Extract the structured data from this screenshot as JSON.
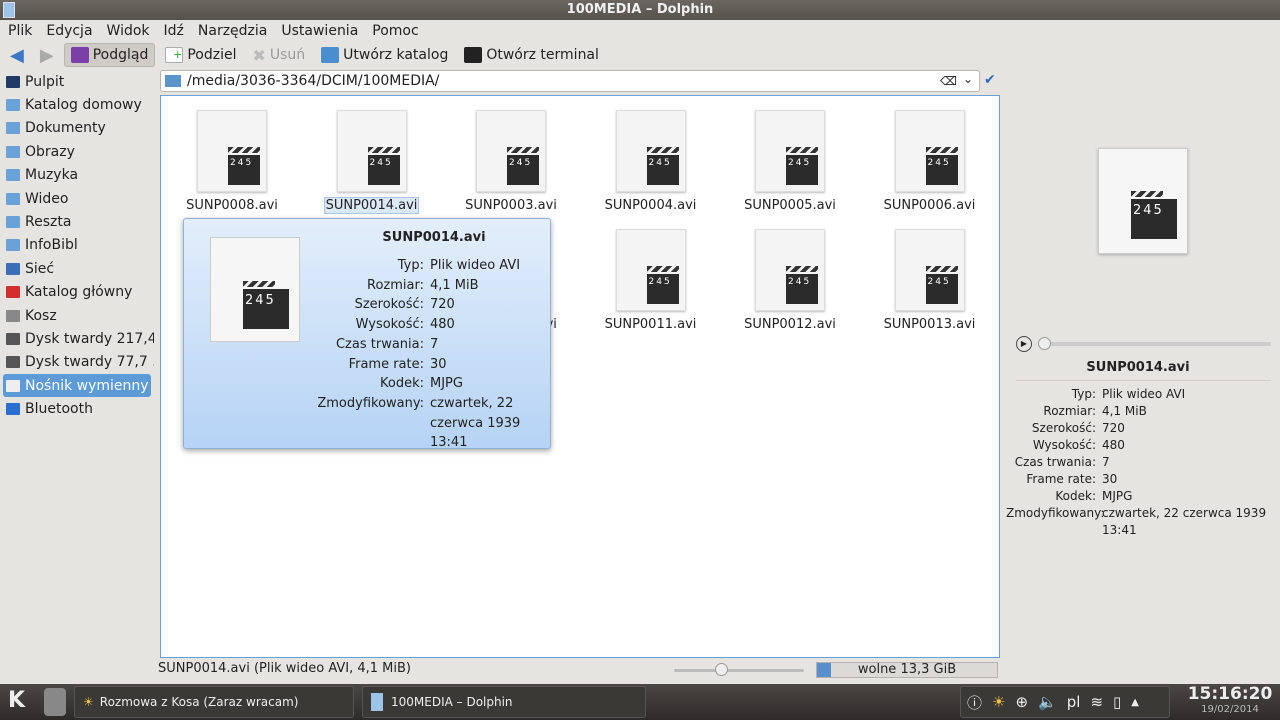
{
  "window": {
    "title": "100MEDIA – Dolphin"
  },
  "menu": [
    "Plik",
    "Edycja",
    "Widok",
    "Idź",
    "Narzędzia",
    "Ustawienia",
    "Pomoc"
  ],
  "toolbar": {
    "preview": "Podgląd",
    "split": "Podziel",
    "delete": "Usuń",
    "new_folder": "Utwórz katalog",
    "terminal": "Otwórz terminal"
  },
  "sidebar": [
    {
      "label": "Pulpit",
      "icon": "desktop-icon"
    },
    {
      "label": "Katalog domowy",
      "icon": "home-folder-icon"
    },
    {
      "label": "Dokumenty",
      "icon": "folder-icon"
    },
    {
      "label": "Obrazy",
      "icon": "folder-icon"
    },
    {
      "label": "Muzyka",
      "icon": "folder-icon"
    },
    {
      "label": "Wideo",
      "icon": "folder-icon"
    },
    {
      "label": "Reszta",
      "icon": "folder-icon"
    },
    {
      "label": "InfoBibl",
      "icon": "folder-icon"
    },
    {
      "label": "Sieć",
      "icon": "network-icon"
    },
    {
      "label": "Katalog główny",
      "icon": "root-folder-icon"
    },
    {
      "label": "Kosz",
      "icon": "trash-icon"
    },
    {
      "label": "Dysk twardy 217,4...",
      "icon": "hard-disk-icon"
    },
    {
      "label": "Dysk twardy 77,7 ...",
      "icon": "hard-disk-icon"
    },
    {
      "label": "Nośnik wymienny ...",
      "icon": "removable-drive-icon",
      "selected": true
    },
    {
      "label": "Bluetooth",
      "icon": "bluetooth-icon"
    }
  ],
  "address": "/media/3036-3364/DCIM/100MEDIA/",
  "files": [
    {
      "name": "SUNP0008.avi"
    },
    {
      "name": "SUNP0014.avi",
      "selected": true
    },
    {
      "name": "SUNP0003.avi"
    },
    {
      "name": "SUNP0004.avi"
    },
    {
      "name": "SUNP0005.avi"
    },
    {
      "name": "SUNP0006.avi"
    },
    {
      "name": ""
    },
    {
      "name": ""
    },
    {
      "name": "SUNP0010.avi"
    },
    {
      "name": "SUNP0011.avi"
    },
    {
      "name": "SUNP0012.avi"
    },
    {
      "name": "SUNP0013.avi"
    }
  ],
  "clapper_text": "245",
  "info": {
    "title": "SUNP0014.avi",
    "rows": [
      {
        "k": "Typ:",
        "v": "Plik wideo AVI"
      },
      {
        "k": "Rozmiar:",
        "v": "4,1 MiB"
      },
      {
        "k": "Szerokość:",
        "v": "720"
      },
      {
        "k": "Wysokość:",
        "v": "480"
      },
      {
        "k": "Czas trwania:",
        "v": "7"
      },
      {
        "k": "Frame rate:",
        "v": "30"
      },
      {
        "k": "Kodek:",
        "v": "MJPG"
      },
      {
        "k": "Zmodyfikowany:",
        "v": "czwartek, 22 czerwca 1939 13:41"
      }
    ]
  },
  "status": {
    "text": "SUNP0014.avi (Plik wideo AVI, 4,1 MiB)",
    "free": "wolne 13,3 GiB",
    "used_fraction": 0.08,
    "zoom_fraction": 0.35
  },
  "taskbar": {
    "tasks": [
      "Rozmowa z Kosa (Zaraz wracam)",
      "100MEDIA – Dolphin"
    ],
    "lang": "pl",
    "time": "15:16:20",
    "date": "19/02/2014"
  }
}
